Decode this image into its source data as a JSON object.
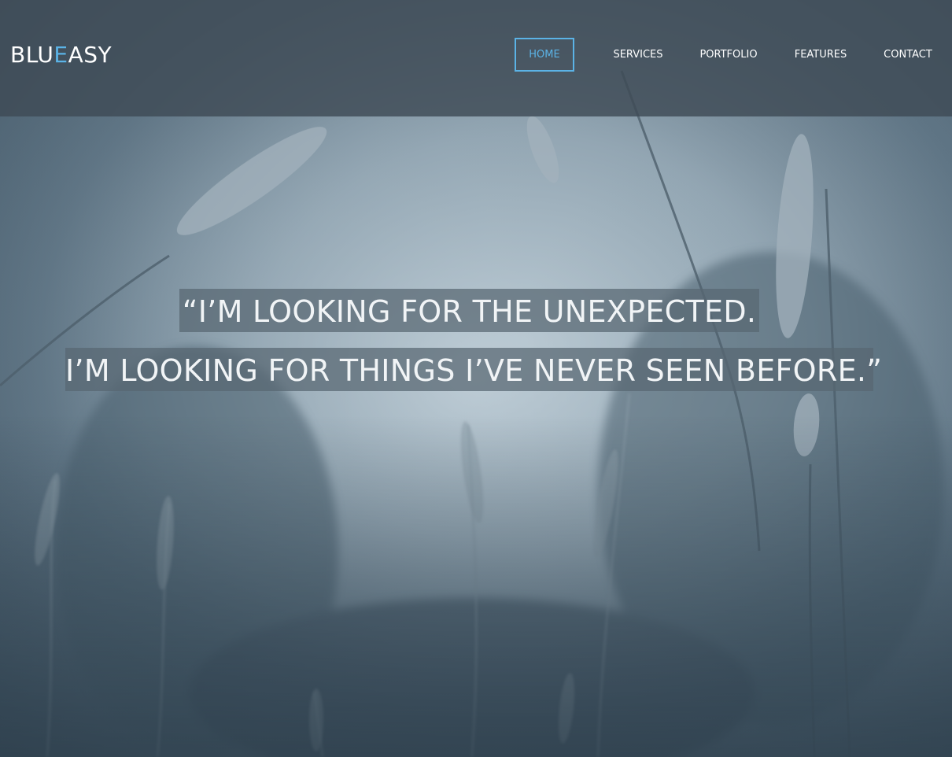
{
  "brand": {
    "part1": "BLU",
    "part2": "E",
    "part3": "ASY"
  },
  "nav": {
    "items": [
      {
        "label": "HOME",
        "active": true
      },
      {
        "label": "SERVICES",
        "active": false
      },
      {
        "label": "PORTFOLIO",
        "active": false
      },
      {
        "label": "FEATURES",
        "active": false
      },
      {
        "label": "CONTACT",
        "active": false
      }
    ]
  },
  "hero": {
    "quote_line_1": "“I’M LOOKING FOR THE UNEXPECTED.",
    "quote_line_2": "I’M LOOKING FOR THINGS I’VE NEVER SEEN BEFORE.”"
  },
  "colors": {
    "accent": "#5bb3e6",
    "header_bg": "#3e4a56",
    "text": "#ffffff"
  }
}
